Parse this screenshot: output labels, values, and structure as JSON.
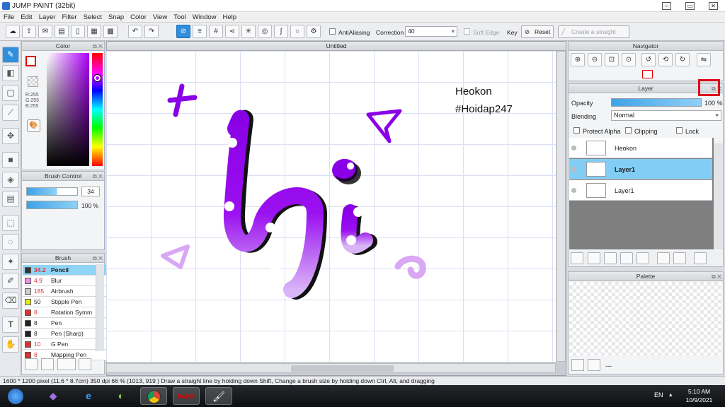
{
  "window": {
    "title": "JUMP PAINT (32bit)"
  },
  "menu": [
    "File",
    "Edit",
    "Layer",
    "Filter",
    "Select",
    "Snap",
    "Color",
    "View",
    "Tool",
    "Window",
    "Help"
  ],
  "toolbar": {
    "antialiasing_label": "AntiAliasing",
    "correction_label": "Correction",
    "correction_value": "40",
    "soft_edge_label": "Soft Edge",
    "key_label": "Key",
    "reset_label": "Reset",
    "straight_line_label": "Create a straight line"
  },
  "color_panel": {
    "title": "Color",
    "r": "R:255",
    "g": "G:255",
    "b": "B:255"
  },
  "brush_control": {
    "title": "Brush Control",
    "size": "34",
    "opacity": "100 %"
  },
  "brush_panel": {
    "title": "Brush",
    "items": [
      {
        "size": "34.2",
        "name": "Pencil",
        "color": "#333333"
      },
      {
        "size": "4.9",
        "name": "Blur",
        "color": "#f08ee8"
      },
      {
        "size": "185",
        "name": "Airbrush",
        "color": "#cccccc"
      },
      {
        "size": "50",
        "name": "Stipple Pen",
        "color": "#e8e810"
      },
      {
        "size": "8",
        "name": "Rotation Symm",
        "color": "#e03030"
      },
      {
        "size": "8",
        "name": "Pen",
        "color": "#222222"
      },
      {
        "size": "8",
        "name": "Pen (Sharp)",
        "color": "#222222"
      },
      {
        "size": "10",
        "name": "G Pen",
        "color": "#e03030"
      },
      {
        "size": "8",
        "name": "Mapping Pen",
        "color": "#e03030"
      }
    ]
  },
  "canvas": {
    "tab_title": "Untitled",
    "text_line1": "Heokon",
    "text_line2": "#Hoidap247"
  },
  "navigator": {
    "title": "Navigator"
  },
  "layer_panel": {
    "title": "Layer",
    "opacity_label": "Opacity",
    "opacity_value": "100 %",
    "blending_label": "Blending",
    "blending_value": "Normal",
    "protect_alpha": "Protect Alpha",
    "clipping": "Clipping",
    "lock": "Lock",
    "layers": [
      {
        "name": "Heokon",
        "selected": false
      },
      {
        "name": "Layer1",
        "selected": true
      },
      {
        "name": "Layer1",
        "selected": false
      }
    ]
  },
  "palette": {
    "title": "Palette",
    "footer": "---"
  },
  "status": {
    "text": "1600 * 1200 pixel   (11.6 * 8.7cm)   350 dpi   66 %   (1013, 919 )   Draw a straight line by holding down Shift, Change a brush size by holding down Ctrl, Alt, and dragging"
  },
  "taskbar": {
    "lang": "EN",
    "time": "5:10 AM",
    "date": "10/9/2021"
  },
  "colors": {
    "accent": "#2f8fde",
    "selected_row": "#82cdf4",
    "stroke_purple": "#8a00e6"
  }
}
